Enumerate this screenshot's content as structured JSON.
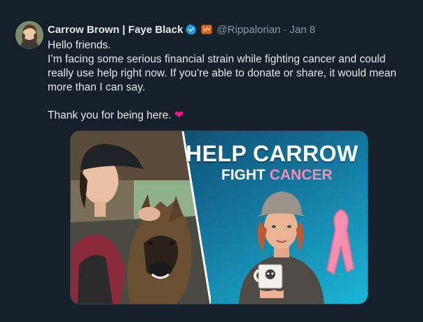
{
  "tweet": {
    "display_name": "Carrow Brown | Faye Black",
    "handle": "@Rippalorian",
    "separator": "·",
    "date": "Jan 8",
    "lines": [
      "Hello friends.",
      "I’m facing some serious financial strain while fighting cancer and could really use help right now. If you’re able to donate or share, it would mean more than I can say."
    ],
    "closing": "Thank you for being here.",
    "heart_glyph": "❤"
  },
  "media": {
    "title_line1": "HELP CARROW",
    "title_line2a": "FIGHT",
    "title_line2b": "CANCER"
  },
  "colors": {
    "background": "#15202b",
    "text": "#e7e9ea",
    "secondary": "#8b98a5",
    "verified": "#1d9bf0",
    "heart": "#f91880",
    "banner_teal": "#1aa8c8",
    "ribbon_pink": "#f48fb1"
  },
  "icons": {
    "verified": "verified-badge-icon",
    "flag": "affiliate-badge-icon",
    "heart": "heart-emoji-icon"
  }
}
